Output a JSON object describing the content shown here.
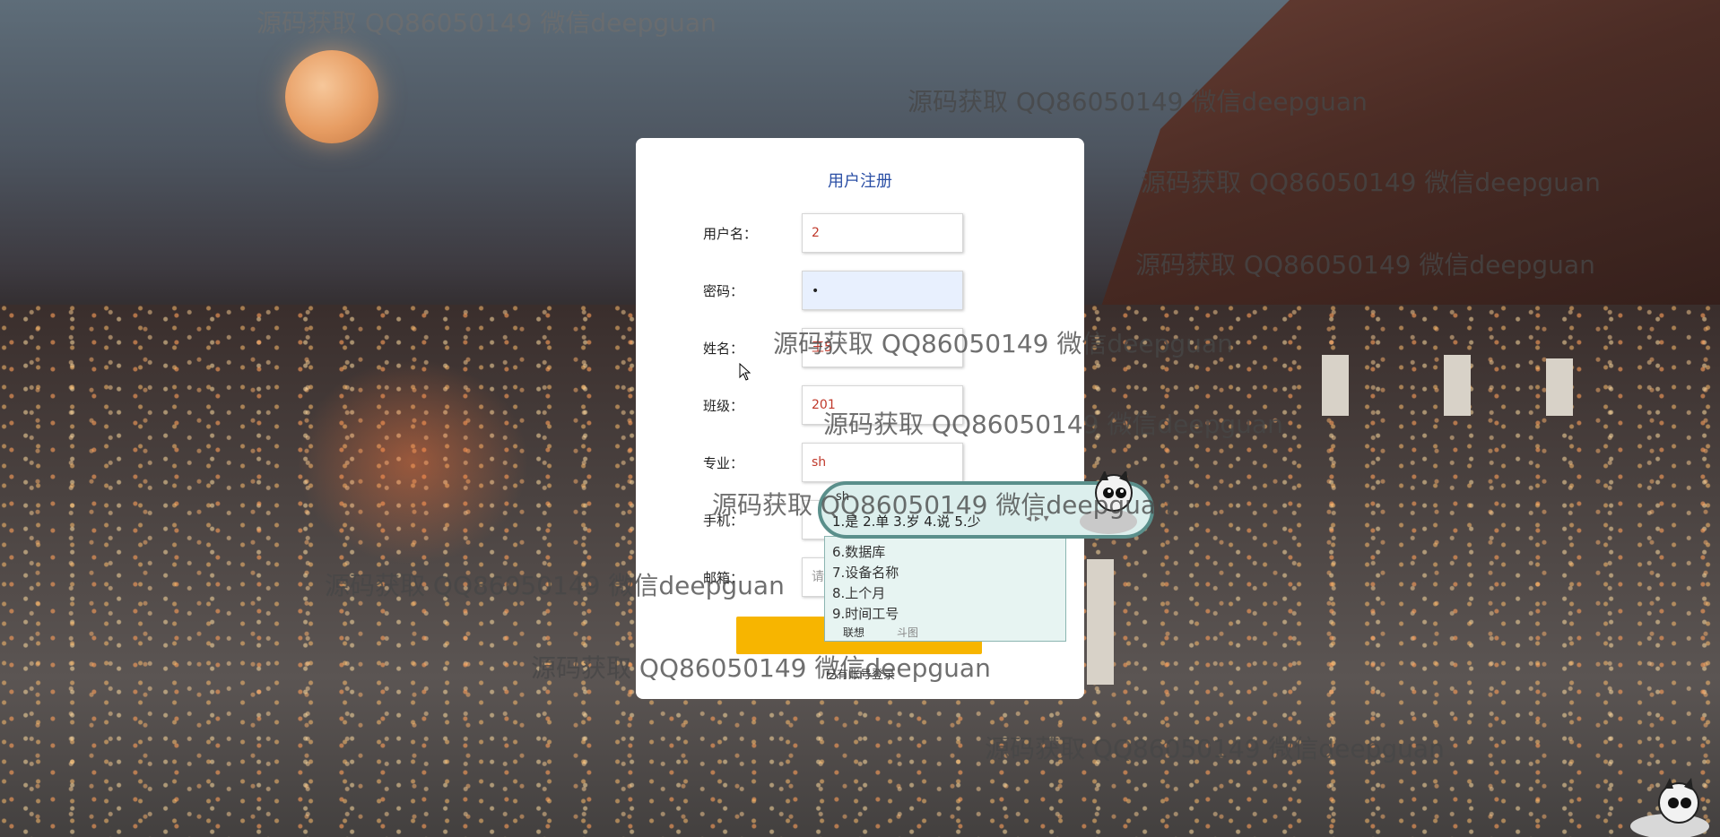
{
  "form": {
    "title": "用户注册",
    "fields": [
      {
        "label": "用户名：",
        "value": "2",
        "placeholder": ""
      },
      {
        "label": "密码：",
        "value": "•",
        "placeholder": ""
      },
      {
        "label": "姓名：",
        "value": "王5",
        "placeholder": ""
      },
      {
        "label": "班级：",
        "value": "201",
        "placeholder": ""
      },
      {
        "label": "专业：",
        "value": "sh",
        "placeholder": ""
      },
      {
        "label": "手机：",
        "value": "",
        "placeholder": ""
      },
      {
        "label": "邮箱：",
        "value": "",
        "placeholder": "请"
      }
    ],
    "submit_label": "",
    "login_link": "已有账号登录"
  },
  "ime": {
    "pinyin": "sh",
    "candidates_row": "1.是  2.单  3.岁  4.说  5.少",
    "list": [
      "6.数据库",
      "7.设备名称",
      "8.上个月",
      "9.时间工号"
    ],
    "tab_active": "联想",
    "tab_inactive": "斗图"
  },
  "watermark": "源码获取 QQ86050149 微信deepguan"
}
